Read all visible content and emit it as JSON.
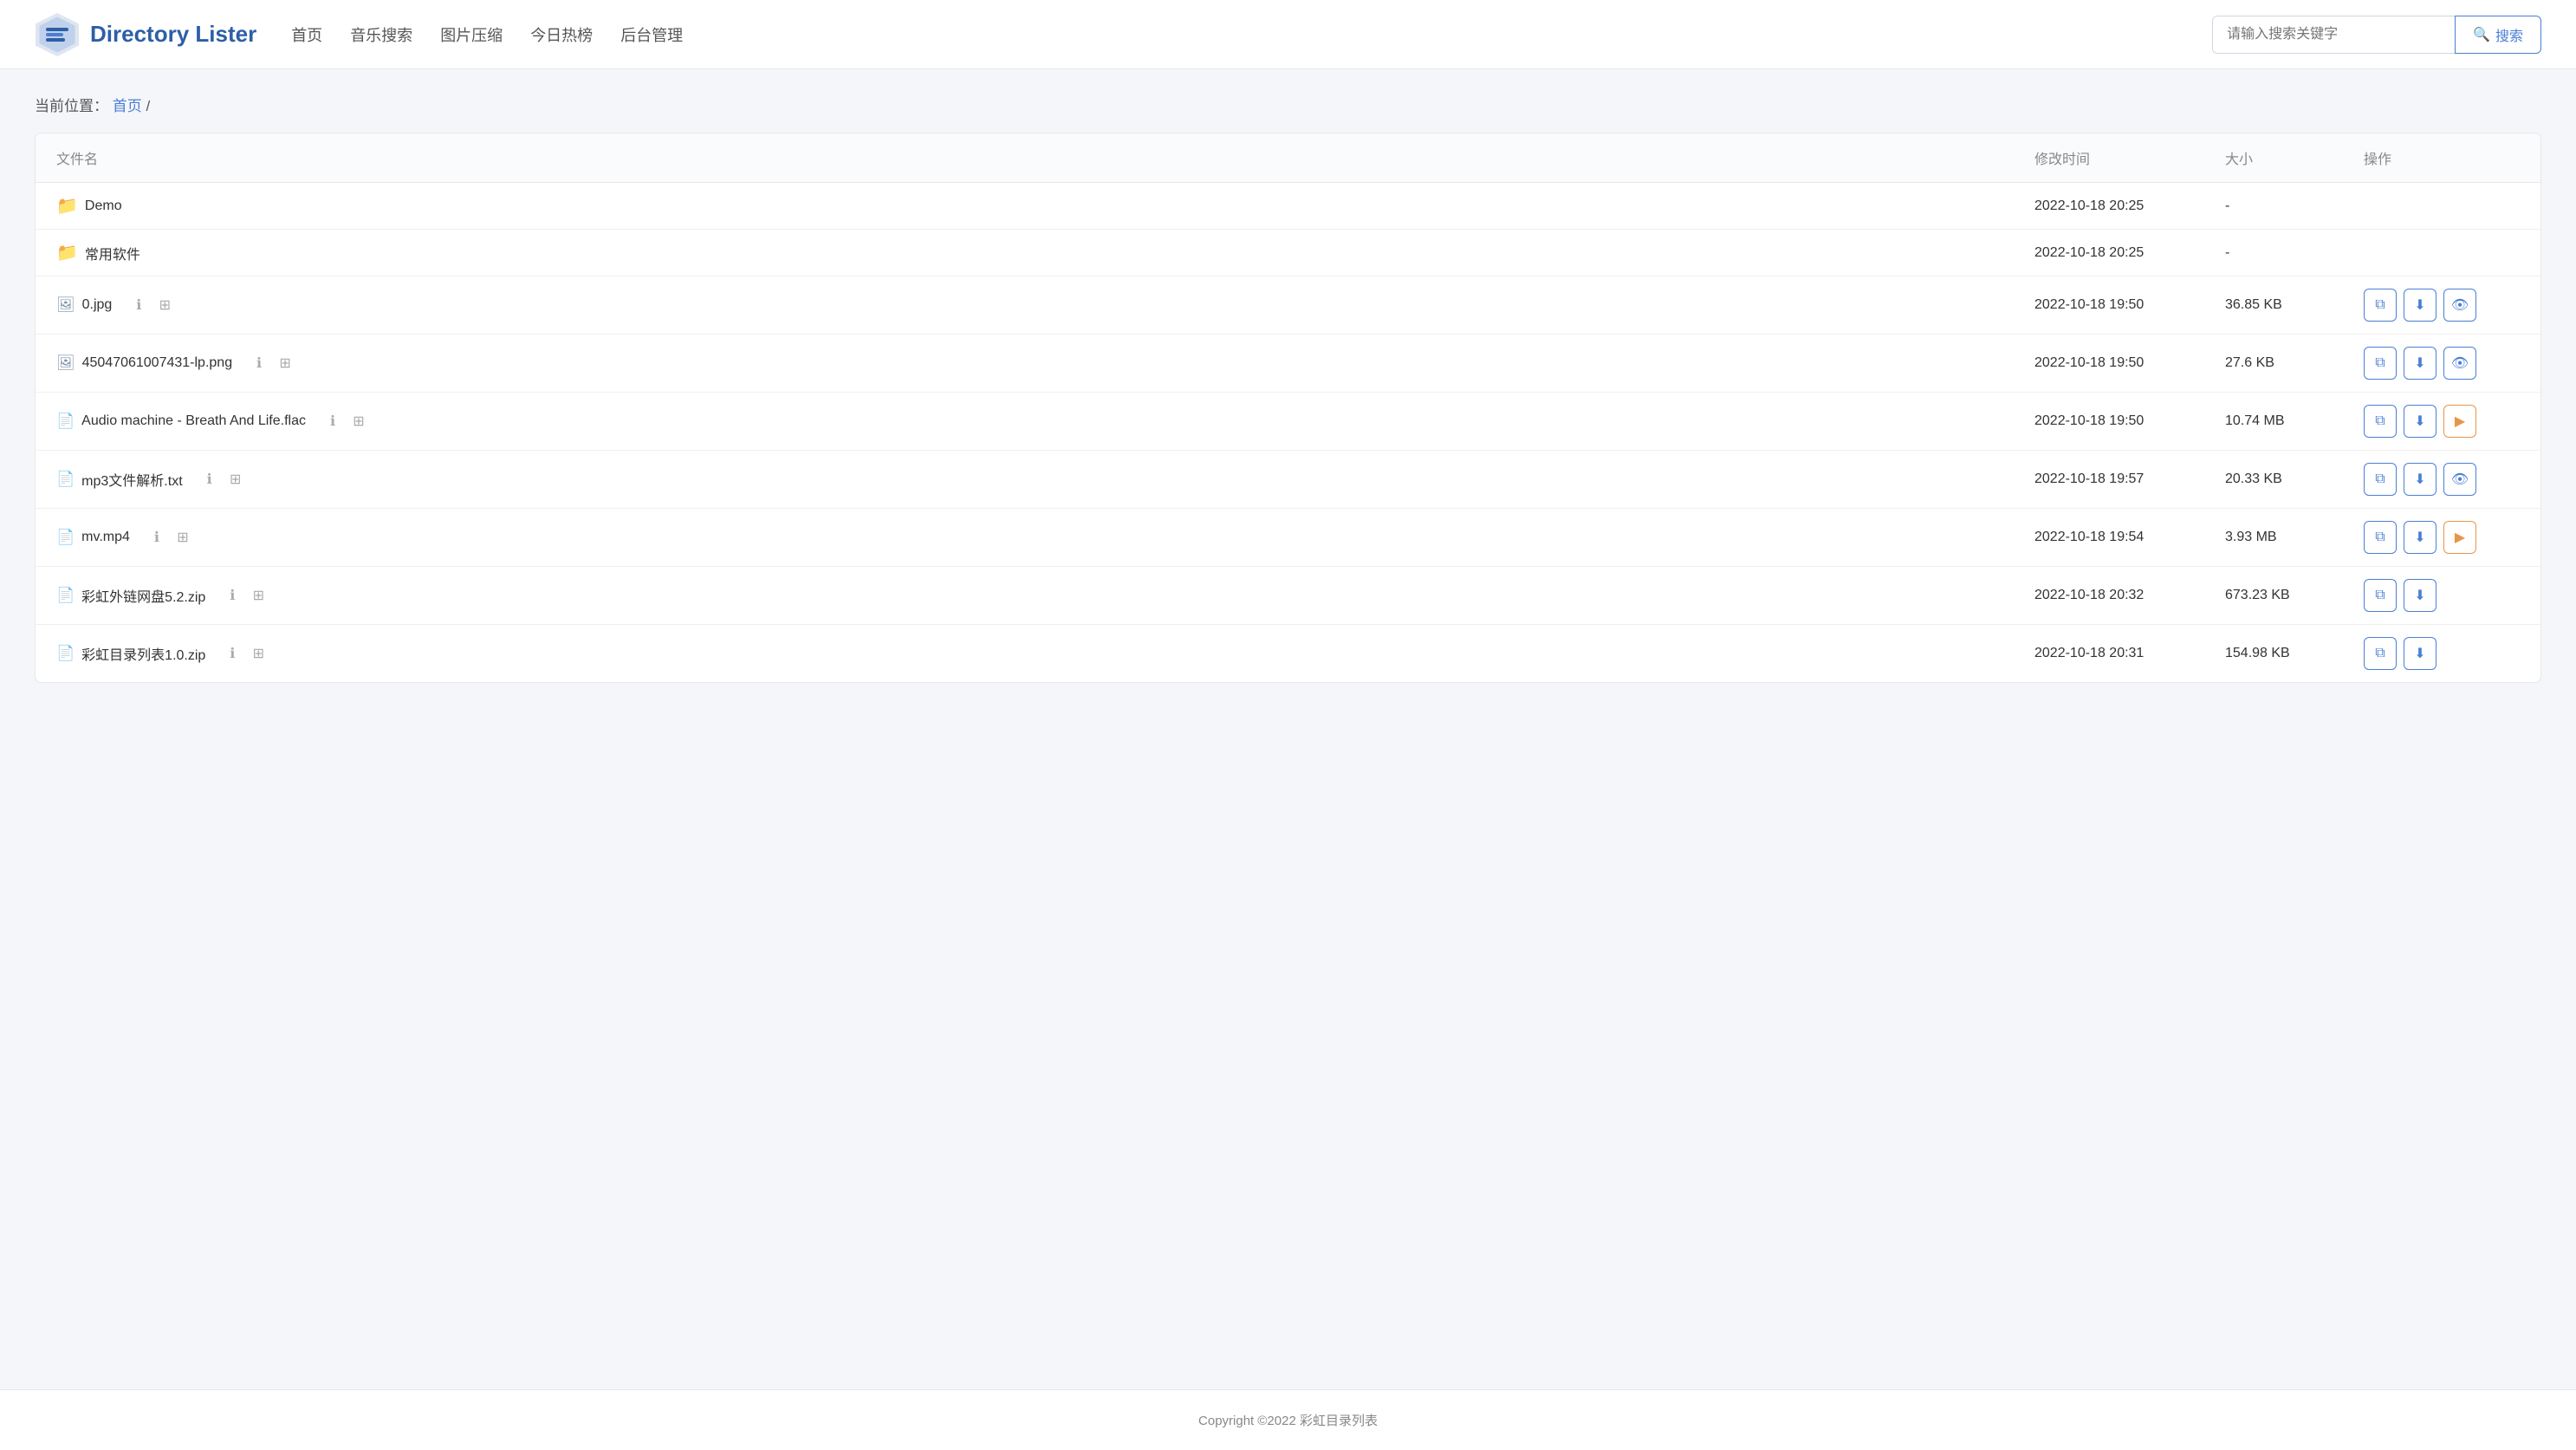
{
  "header": {
    "logo_text": "Directory Lister",
    "nav": [
      {
        "label": "首页",
        "id": "home"
      },
      {
        "label": "音乐搜索",
        "id": "music"
      },
      {
        "label": "图片压缩",
        "id": "imgcompress"
      },
      {
        "label": "今日热榜",
        "id": "hot"
      },
      {
        "label": "后台管理",
        "id": "admin"
      }
    ],
    "search_placeholder": "请输入搜索关键字",
    "search_btn_label": "搜索"
  },
  "breadcrumb": {
    "prefix": "当前位置：",
    "home_link": "首页",
    "separator": "/"
  },
  "table": {
    "columns": [
      "文件名",
      "修改时间",
      "大小",
      "操作"
    ],
    "rows": [
      {
        "type": "folder",
        "name": "Demo",
        "modified": "2022-10-18 20:25",
        "size": "-",
        "actions": []
      },
      {
        "type": "folder",
        "name": "常用软件",
        "modified": "2022-10-18 20:25",
        "size": "-",
        "actions": []
      },
      {
        "type": "image",
        "name": "0.jpg",
        "modified": "2022-10-18 19:50",
        "size": "36.85 KB",
        "actions": [
          "copy",
          "download",
          "view"
        ]
      },
      {
        "type": "image",
        "name": "45047061007431-lp.png",
        "modified": "2022-10-18 19:50",
        "size": "27.6 KB",
        "actions": [
          "copy",
          "download",
          "view"
        ]
      },
      {
        "type": "audio",
        "name": "Audio machine - Breath And Life.flac",
        "modified": "2022-10-18 19:50",
        "size": "10.74 MB",
        "actions": [
          "copy",
          "download",
          "play"
        ]
      },
      {
        "type": "text",
        "name": "mp3文件解析.txt",
        "modified": "2022-10-18 19:57",
        "size": "20.33 KB",
        "actions": [
          "copy",
          "download",
          "view"
        ]
      },
      {
        "type": "video",
        "name": "mv.mp4",
        "modified": "2022-10-18 19:54",
        "size": "3.93 MB",
        "actions": [
          "copy",
          "download",
          "play"
        ]
      },
      {
        "type": "zip",
        "name": "彩虹外链网盘5.2.zip",
        "modified": "2022-10-18 20:32",
        "size": "673.23 KB",
        "actions": [
          "copy",
          "download"
        ]
      },
      {
        "type": "zip",
        "name": "彩虹目录列表1.0.zip",
        "modified": "2022-10-18 20:31",
        "size": "154.98 KB",
        "actions": [
          "copy",
          "download"
        ]
      }
    ]
  },
  "footer": {
    "text": "Copyright ©2022 彩虹目录列表"
  },
  "icons": {
    "search": "🔍",
    "folder": "📁",
    "file": "📄",
    "copy": "⧉",
    "download": "⬇",
    "view": "👁",
    "play": "▶",
    "info": "ℹ",
    "qr": "⊞"
  }
}
